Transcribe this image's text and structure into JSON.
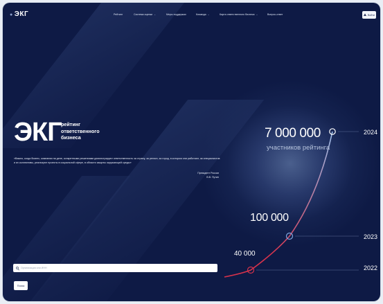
{
  "header": {
    "logo": "ЭКГ",
    "nav": [
      {
        "label": "Рейтинг",
        "has_dropdown": false
      },
      {
        "label": "Система оценки",
        "has_dropdown": true
      },
      {
        "label": "Меры поддержки",
        "has_dropdown": false
      },
      {
        "label": "Команда",
        "has_dropdown": true
      },
      {
        "label": "Карта ответственного бизнеса",
        "has_dropdown": true
      },
      {
        "label": "Вопрос-ответ",
        "has_dropdown": false
      }
    ],
    "login_label": "Войти"
  },
  "hero": {
    "brand": "ЭКГ",
    "tagline": [
      "рейтинг",
      "ответственного",
      "бизнеса"
    ],
    "quote": "«Важно, когда бизнес, компании на деле, конкретными решениями демонстрируют ответственность за страну, за регион, за город, в котором они работают, за специалистов и их коллективы, реализуют проекты в социальной сфере, в области защиты окружающей среды»",
    "author_role": "Президент России",
    "author_name": "В.В. Путин",
    "search_placeholder": "Организация или ИНН",
    "search_button": "Поиск"
  },
  "chart_data": {
    "type": "line",
    "x": [
      "2022",
      "2023",
      "2024"
    ],
    "series": [
      {
        "values": [
          40000,
          100000,
          7000000
        ]
      }
    ],
    "labels": [
      "40 000",
      "100 000",
      "7 000 000"
    ],
    "annotation": "участников рейтинга",
    "colors": {
      "start": "#d8324b",
      "end": "#9ec3ef"
    }
  }
}
